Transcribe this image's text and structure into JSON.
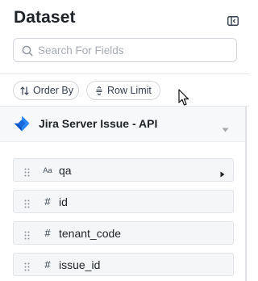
{
  "panel": {
    "title": "Dataset",
    "search": {
      "placeholder": "Search For Fields",
      "value": ""
    },
    "actions": [
      {
        "label": "Order By",
        "icon": "sort-arrows-icon"
      },
      {
        "label": "Row Limit",
        "icon": "row-limit-icon"
      }
    ],
    "source": {
      "title": "Jira Server Issue - API",
      "icon": "jira-logo"
    },
    "fields": [
      {
        "name": "qa",
        "type_label": "Aa",
        "type": "string",
        "expandable": true
      },
      {
        "name": "id",
        "type_label": "#",
        "type": "number",
        "expandable": false
      },
      {
        "name": "tenant_code",
        "type_label": "#",
        "type": "number",
        "expandable": false
      },
      {
        "name": "issue_id",
        "type_label": "#",
        "type": "number",
        "expandable": false
      }
    ]
  },
  "colors": {
    "border": "#d4d8dd",
    "field_bg": "#f5f6f7",
    "source_bg": "#f7f8f9",
    "jira_blue": "#2684ff",
    "jira_dark": "#0052cc"
  }
}
